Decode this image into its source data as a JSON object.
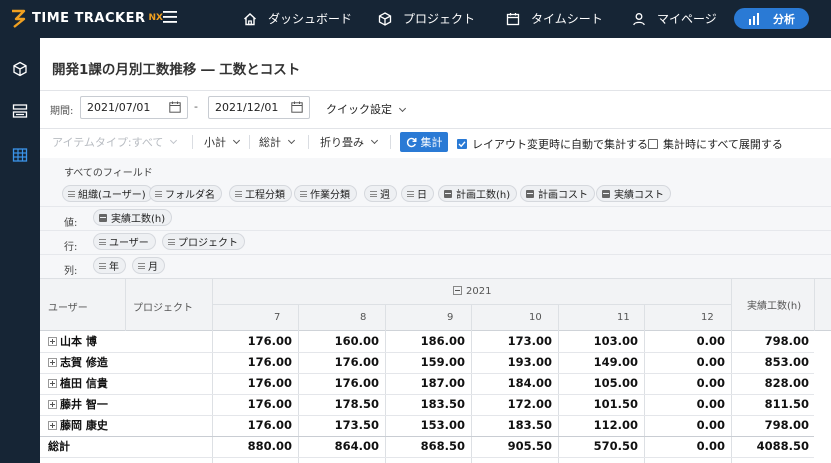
{
  "app": {
    "logo_text": "TIME TRACKER",
    "logo_suffix": "NX",
    "accent": "#2a7ad5",
    "topbar_bg": "#162535"
  },
  "nav": {
    "menu_icon": "hamburger-icon",
    "items": [
      {
        "label": "ダッシュボード",
        "icon": "home-icon"
      },
      {
        "label": "プロジェクト",
        "icon": "cube-icon"
      },
      {
        "label": "タイムシート",
        "icon": "calendar-icon"
      },
      {
        "label": "マイページ",
        "icon": "user-icon"
      }
    ],
    "active": {
      "label": "分析",
      "icon": "bar-chart-icon"
    }
  },
  "rail": {
    "icons": [
      "cube-icon",
      "layout-icon",
      "table-icon"
    ]
  },
  "page": {
    "title": "開発1課の月別工数推移 ― 工数とコスト"
  },
  "filters": {
    "period_label": "期間:",
    "start_date": "2021/07/01",
    "end_date": "2021/12/01",
    "separator": "-",
    "quick_setting": "クイック設定"
  },
  "toolbar": {
    "item_type": "アイテムタイプ:すべて",
    "subtotal": "小計",
    "total": "総計",
    "fold": "折り畳み",
    "aggregate": "集計",
    "auto_aggregate": "レイアウト変更時に自動で集計する",
    "auto_aggregate_checked": true,
    "expand_all": "集計時にすべて展開する",
    "expand_all_checked": false
  },
  "fields": {
    "all_fields_label": "すべてのフィールド",
    "all_fields": [
      "組織(ユーザー)",
      "フォルダ名",
      "工程分類",
      "作業分類",
      "週",
      "日",
      "計画工数(h)",
      "計画コスト",
      "実績コスト"
    ],
    "values_label": "値:",
    "values": [
      "実績工数(h)"
    ],
    "rows_label": "行:",
    "rows": [
      "ユーザー",
      "プロジェクト"
    ],
    "columns_label": "列:",
    "columns": [
      "年",
      "月"
    ]
  },
  "grid": {
    "row_header_1": "ユーザー",
    "row_header_2": "プロジェクト",
    "year": "2021",
    "months": [
      "7",
      "8",
      "9",
      "10",
      "11",
      "12"
    ],
    "total_header": "実績工数(h)",
    "rows": [
      {
        "user": "山本 博",
        "values": [
          "176.00",
          "160.00",
          "186.00",
          "173.00",
          "103.00",
          "0.00"
        ],
        "total": "798.00"
      },
      {
        "user": "志賀 修造",
        "values": [
          "176.00",
          "176.00",
          "159.00",
          "193.00",
          "149.00",
          "0.00"
        ],
        "total": "853.00"
      },
      {
        "user": "植田 信貴",
        "values": [
          "176.00",
          "176.00",
          "187.00",
          "184.00",
          "105.00",
          "0.00"
        ],
        "total": "828.00"
      },
      {
        "user": "藤井 智一",
        "values": [
          "176.00",
          "178.50",
          "183.50",
          "172.00",
          "101.50",
          "0.00"
        ],
        "total": "811.50"
      },
      {
        "user": "藤岡 康史",
        "values": [
          "176.00",
          "173.50",
          "153.00",
          "183.50",
          "112.00",
          "0.00"
        ],
        "total": "798.00"
      }
    ],
    "grand_total_label": "総計",
    "grand_total": {
      "values": [
        "880.00",
        "864.00",
        "868.50",
        "905.50",
        "570.50",
        "0.00"
      ],
      "total": "4088.50"
    }
  }
}
